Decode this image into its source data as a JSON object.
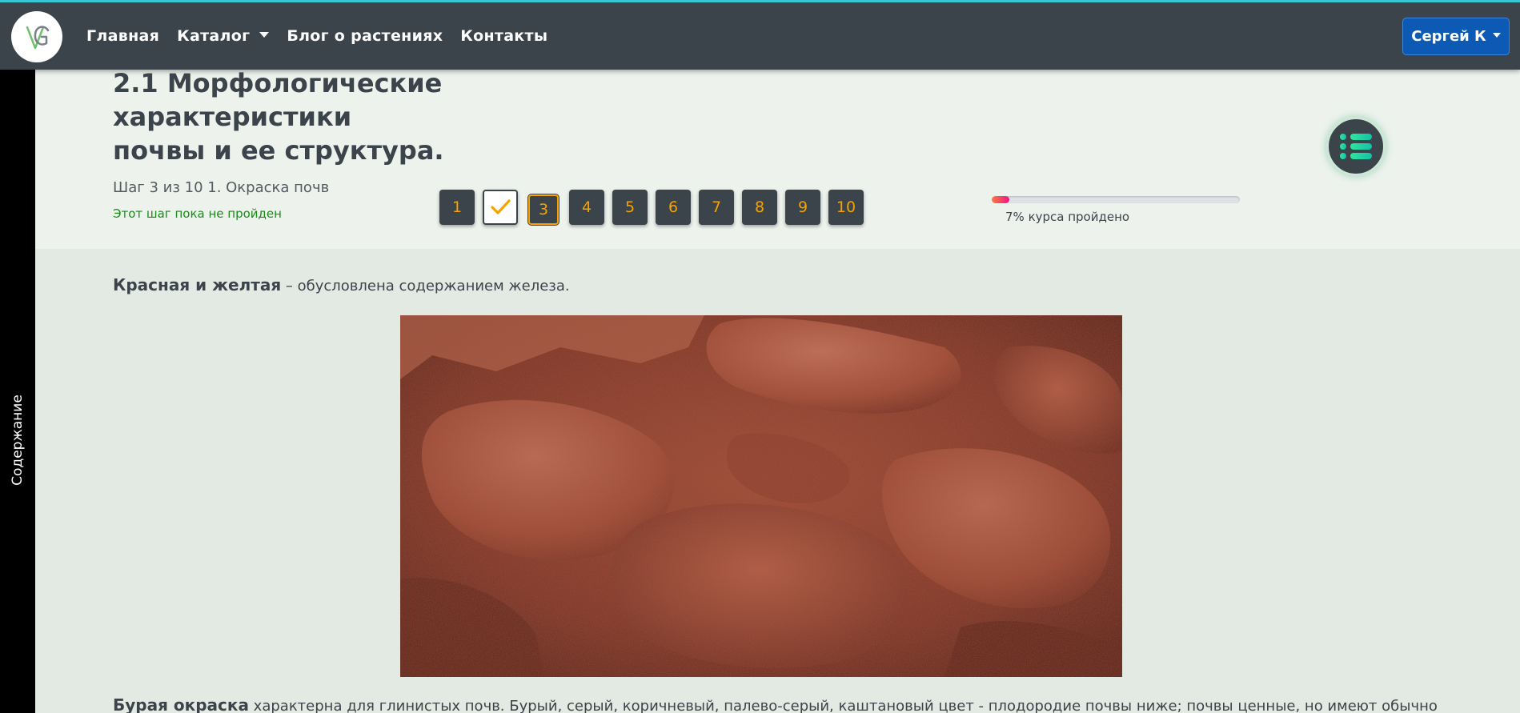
{
  "navbar": {
    "logo_text": "VG",
    "links": [
      "Главная",
      "Каталог",
      "Блог о растениях",
      "Контакты"
    ],
    "user_label": "Сергей К",
    "accent_color": "#37c6d4"
  },
  "sidebar": {
    "label": "Содержание"
  },
  "lesson": {
    "title": "2.1 Морфологические характеристики почвы и ее структура.",
    "step_info": "Шаг 3 из 10 1. Окраска почв",
    "step_status": "Этот шаг пока не пройден",
    "steps": [
      {
        "label": "1",
        "state": "default"
      },
      {
        "label": "",
        "state": "done",
        "icon": "check-icon"
      },
      {
        "label": "3",
        "state": "current"
      },
      {
        "label": "4",
        "state": "default"
      },
      {
        "label": "5",
        "state": "default"
      },
      {
        "label": "6",
        "state": "default"
      },
      {
        "label": "7",
        "state": "default"
      },
      {
        "label": "8",
        "state": "default"
      },
      {
        "label": "9",
        "state": "default"
      },
      {
        "label": "10",
        "state": "default"
      }
    ],
    "progress": {
      "percent": 7,
      "label": "7% курса пройдено"
    },
    "toc_icon": "list-icon"
  },
  "content": {
    "para1_bold": "Красная и желтая",
    "para1_rest": " – обусловлена содержанием железа.",
    "image_icon": "red-soil-photo",
    "para2_bold": "Бурая окраска",
    "para2_rest": " характерна для глинистых почв. Бурый, серый, коричневый, палево-серый, каштановый цвет - плодородие почвы ниже; почвы ценные, но имеют обычно"
  },
  "colors": {
    "navbar_bg": "#3b444b",
    "step_number": "#f4a300",
    "user_button": "#0d5ab4",
    "status_green": "#198c19",
    "page_bg": "#e3eae3",
    "header_bg": "#edf2ed"
  }
}
